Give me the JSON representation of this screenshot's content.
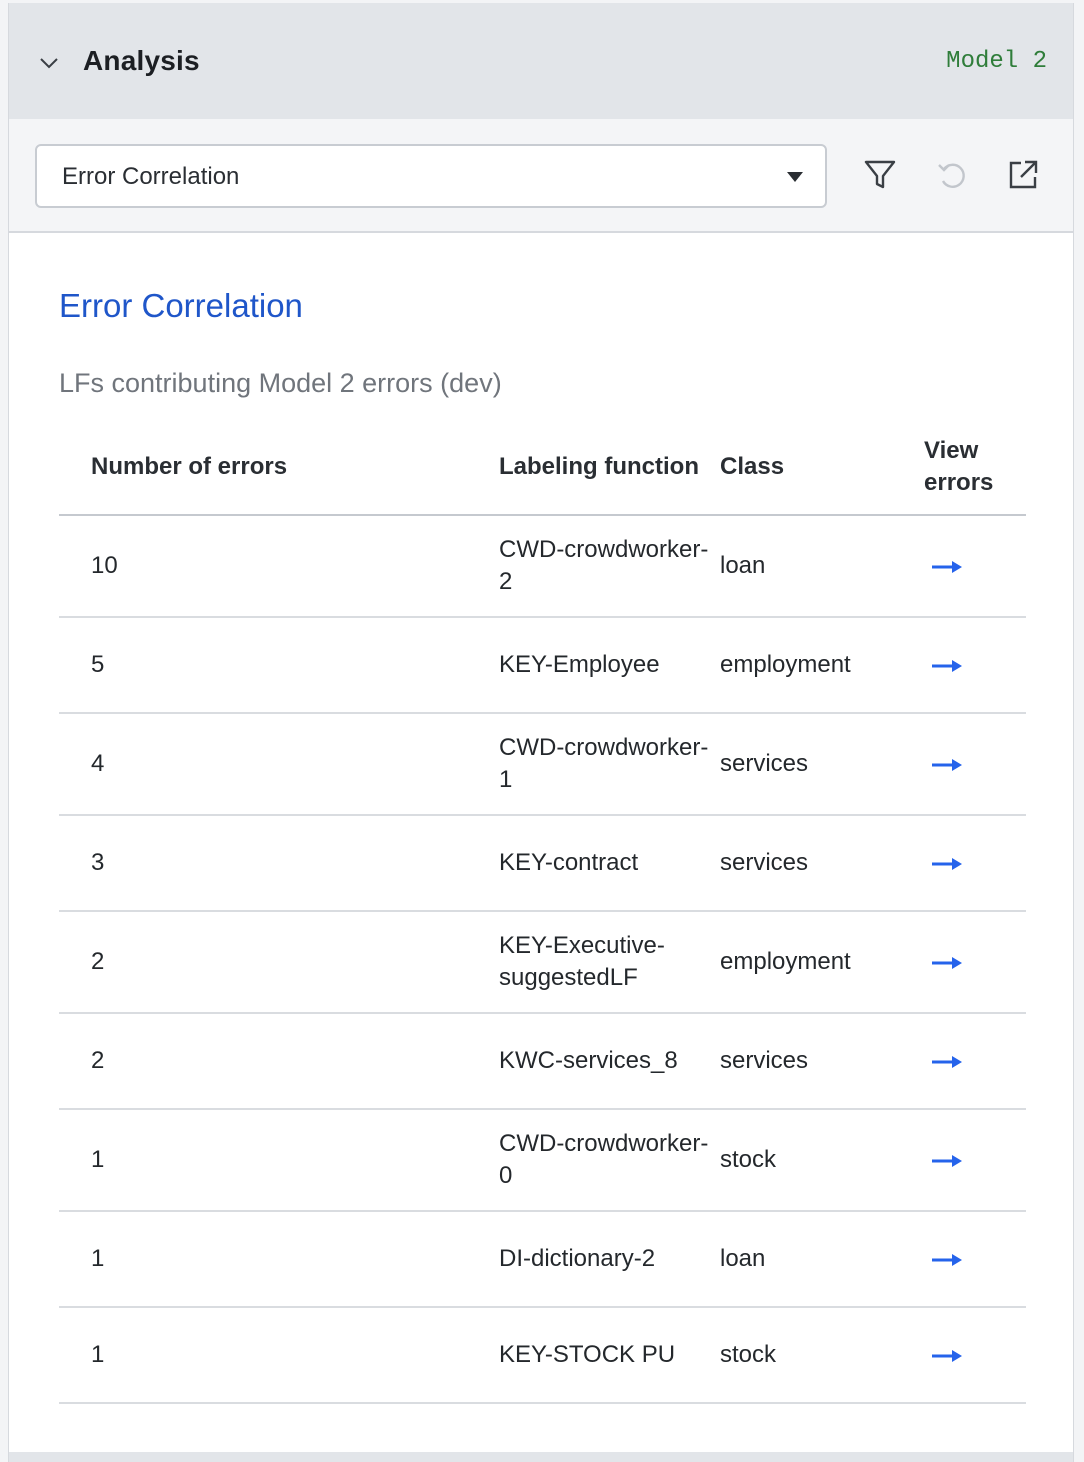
{
  "header": {
    "title": "Analysis",
    "model_tag": "Model 2"
  },
  "toolbar": {
    "selected_view": "Error Correlation",
    "icons": [
      "filter-icon",
      "undo-icon",
      "open-external-icon"
    ]
  },
  "main": {
    "title": "Error Correlation",
    "subtitle": "LFs contributing Model 2 errors (dev)",
    "columns": {
      "num": "Number of errors",
      "lf": "Labeling function",
      "cls": "Class",
      "view": "View errors"
    },
    "rows": [
      {
        "num": "10",
        "lf": "CWD-crowdworker-2",
        "cls": "loan",
        "cls_type": "loan"
      },
      {
        "num": "5",
        "lf": "KEY-Employee",
        "cls": "employment",
        "cls_type": "employment"
      },
      {
        "num": "4",
        "lf": "CWD-crowdworker-1",
        "cls": "services",
        "cls_type": "services"
      },
      {
        "num": "3",
        "lf": "KEY-contract",
        "cls": "services",
        "cls_type": "services"
      },
      {
        "num": "2",
        "lf": "KEY-Executive-suggestedLF",
        "cls": "employment",
        "cls_type": "employment"
      },
      {
        "num": "2",
        "lf": "KWC-services_8",
        "cls": "services",
        "cls_type": "services"
      },
      {
        "num": "1",
        "lf": "CWD-crowdworker-0",
        "cls": "stock",
        "cls_type": "stock"
      },
      {
        "num": "1",
        "lf": "DI-dictionary-2",
        "cls": "loan",
        "cls_type": "loan"
      },
      {
        "num": "1",
        "lf": "KEY-STOCK PU",
        "cls": "stock",
        "cls_type": "stock"
      }
    ]
  },
  "colors": {
    "title_blue": "#1f56c9",
    "arrow_blue": "#2563eb",
    "model_green": "#2f7d3a",
    "loan": "#4a7b95",
    "employment": "#6b2d5c",
    "services": "#a02c2c",
    "stock": "#7d9452"
  }
}
